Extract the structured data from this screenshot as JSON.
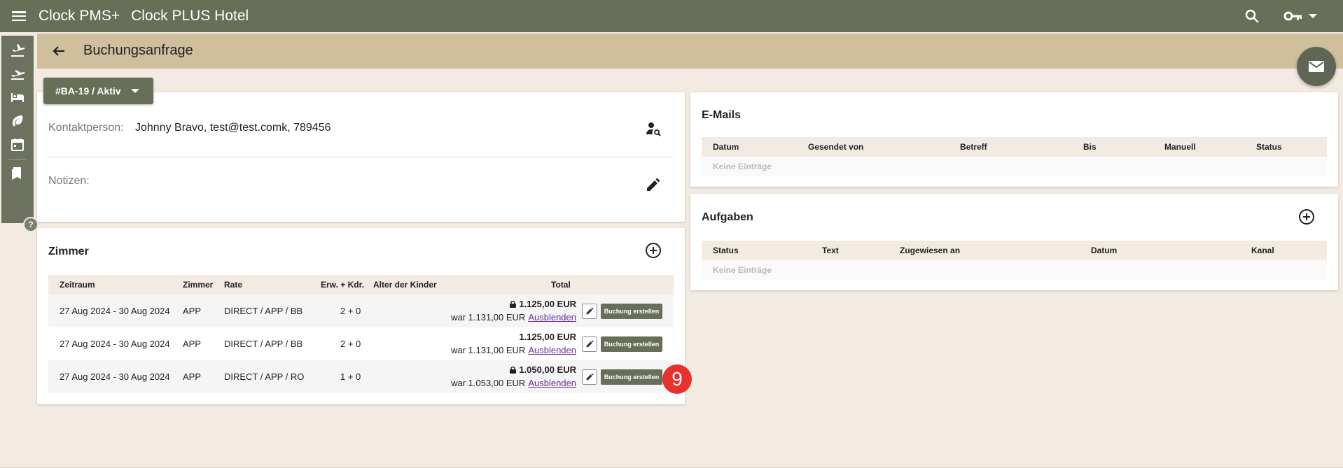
{
  "app": {
    "name": "Clock PMS+",
    "hotel": "Clock PLUS Hotel"
  },
  "header": {
    "title": "Buchungsanfrage",
    "status_button": "#BA-19 / Aktiv"
  },
  "contact": {
    "label": "Kontaktperson:",
    "value": "Johnny Bravo, test@test.comk, 789456"
  },
  "notes": {
    "label": "Notizen:"
  },
  "rooms": {
    "title": "Zimmer",
    "columns": [
      "Zeitraum",
      "Zimmer",
      "Rate",
      "Erw. + Kdr.",
      "Alter der Kinder",
      "Total"
    ],
    "rows": [
      {
        "period": "27 Aug 2024 - 30 Aug 2024",
        "room": "APP",
        "rate": "DIRECT / APP / BB",
        "guests": "2 + 0",
        "kids_age": "",
        "total": "1.125,00 EUR",
        "was": "war 1.131,00 EUR",
        "hide": "Ausblenden",
        "locked": true,
        "action": "Buchung erstellen"
      },
      {
        "period": "27 Aug 2024 - 30 Aug 2024",
        "room": "APP",
        "rate": "DIRECT / APP / BB",
        "guests": "2 + 0",
        "kids_age": "",
        "total": "1.125,00 EUR",
        "was": "war 1.131,00 EUR",
        "hide": "Ausblenden",
        "locked": false,
        "action": "Buchung erstellen"
      },
      {
        "period": "27 Aug 2024 - 30 Aug 2024",
        "room": "APP",
        "rate": "DIRECT / APP / RO",
        "guests": "1 + 0",
        "kids_age": "",
        "total": "1.050,00 EUR",
        "was": "war 1.053,00 EUR",
        "hide": "Ausblenden",
        "locked": true,
        "action": "Buchung erstellen"
      }
    ]
  },
  "emails": {
    "title": "E-Mails",
    "columns": [
      "Datum",
      "Gesendet von",
      "Betreff",
      "Bis",
      "Manuell",
      "Status"
    ],
    "empty": "Keine Einträge"
  },
  "tasks": {
    "title": "Aufgaben",
    "columns": [
      "Status",
      "Text",
      "Zugewiesen an",
      "Datum",
      "Kanal"
    ],
    "empty": "Keine Einträge"
  },
  "badge": {
    "number": "9"
  },
  "help": {
    "label": "?"
  },
  "colors": {
    "topbar": "#676f58",
    "titlebar": "#cfbf9c",
    "background": "#f3ebe2",
    "badge": "#e8302c",
    "link": "#6a2e9c"
  }
}
